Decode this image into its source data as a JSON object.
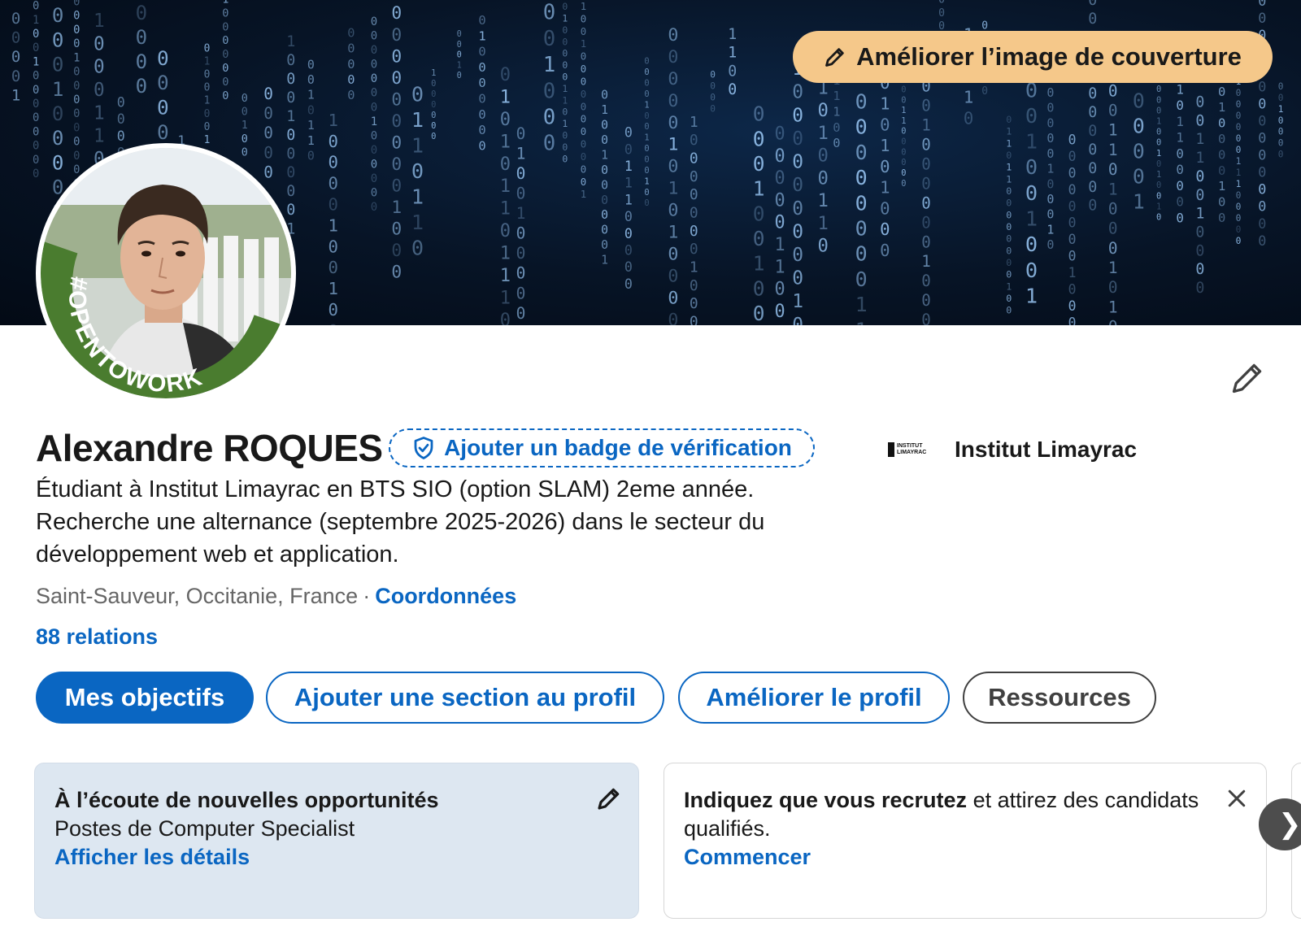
{
  "cover": {
    "edit_button_label": "Améliorer l’image de couverture",
    "edit_icon": "pencil-icon"
  },
  "avatar": {
    "frame_text": "#OPENTOWORK",
    "frame_color": "#4a7c2f"
  },
  "profile": {
    "name": "Alexandre ROQUES",
    "verification_label": "Ajouter un badge de vérification",
    "verification_icon": "shield-check-icon",
    "headline": "Étudiant à Institut Limayrac en BTS SIO (option SLAM) 2eme année. Recherche une alternance (septembre 2025-2026) dans le secteur du développement web et application.",
    "location": "Saint-Sauveur, Occitanie, France",
    "separator": "·",
    "contact_label": "Coordonnées",
    "relations": "88 relations",
    "edit_icon": "pencil-icon"
  },
  "company": {
    "logo_text_top": "INSTITUT",
    "logo_text_bottom": "LIMAYRAC",
    "name": "Institut Limayrac"
  },
  "actions": {
    "goals": "Mes objectifs",
    "add_section": "Ajouter une section au profil",
    "improve": "Améliorer le profil",
    "resources": "Ressources"
  },
  "cards": {
    "open_to_work": {
      "title": "À l’écoute de nouvelles opportunités",
      "subtitle": "Postes de Computer Specialist",
      "link": "Afficher les détails"
    },
    "hiring": {
      "title_bold": "Indiquez que vous recrutez",
      "title_rest": " et attirez des candidats qualifiés.",
      "link": "Commencer"
    },
    "next_icon": "chevron-right-icon",
    "next_glyph": "❯"
  },
  "colors": {
    "primary": "#0a66c2",
    "cover_button": "#f5c88a",
    "open_card_bg": "#dde7f1"
  }
}
